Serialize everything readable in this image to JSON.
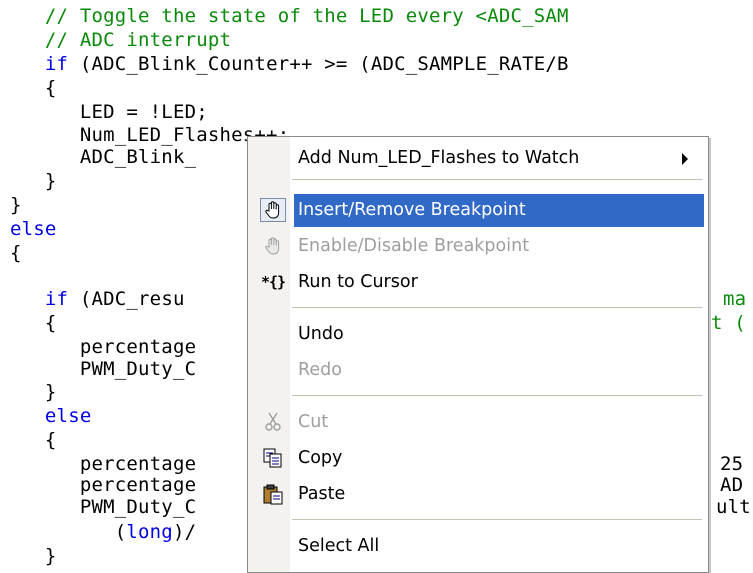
{
  "editor": {
    "lines": [
      {
        "text": "   // Toggle the state of the LED every <ADC_SAM",
        "kind": "comment"
      },
      {
        "text": "   // ADC interrupt",
        "kind": "comment"
      },
      {
        "text": "   if (ADC_Blink_Counter++ >= (ADC_SAMPLE_RATE/B",
        "kind": "if"
      },
      {
        "text": "   {",
        "kind": "normal"
      },
      {
        "text": "      LED = !LED;",
        "kind": "normal"
      },
      {
        "text": "      Num_LED_Flashes++;",
        "kind": "normal"
      },
      {
        "text": "      ADC_Blink_",
        "kind": "normal"
      },
      {
        "text": "   }",
        "kind": "normal"
      },
      {
        "text": "}",
        "kind": "normal"
      },
      {
        "text": "else",
        "kind": "keyword"
      },
      {
        "text": "{",
        "kind": "normal"
      },
      {
        "text": "",
        "kind": "normal"
      },
      {
        "text": "   if (ADC_resu",
        "kind": "if"
      },
      {
        "text": "   {",
        "kind": "normal"
      },
      {
        "text": "      percentage",
        "kind": "normal"
      },
      {
        "text": "      PWM_Duty_C",
        "kind": "normal"
      },
      {
        "text": "   }",
        "kind": "normal"
      },
      {
        "text": "   else",
        "kind": "keyword"
      },
      {
        "text": "   {",
        "kind": "normal"
      },
      {
        "text": "      percentage",
        "kind": "normal"
      },
      {
        "text": "      percentage",
        "kind": "normal"
      },
      {
        "text": "      PWM_Duty_C",
        "kind": "normal"
      },
      {
        "text": "         (long)/",
        "kind": "long"
      },
      {
        "text": "   }",
        "kind": "normal"
      }
    ],
    "right_fragments": [
      "ma",
      "t (",
      "25",
      "AD",
      "ult"
    ]
  },
  "context_menu": {
    "items": [
      {
        "label": "Add Num_LED_Flashes to Watch",
        "icon": "",
        "has_submenu": true
      },
      {
        "label": "Insert/Remove Breakpoint",
        "icon": "hand-breakpoint-icon",
        "highlighted": true
      },
      {
        "label": "Enable/Disable Breakpoint",
        "icon": "hand-breakpoint-disabled-icon",
        "disabled": true
      },
      {
        "label": "Run to Cursor",
        "icon": "run-to-cursor-icon",
        "icon_glyph": "*{}"
      },
      {
        "label": "Undo",
        "icon": ""
      },
      {
        "label": "Redo",
        "icon": "",
        "disabled": true
      },
      {
        "label": "Cut",
        "icon": "scissors-icon",
        "disabled": true
      },
      {
        "label": "Copy",
        "icon": "copy-icon"
      },
      {
        "label": "Paste",
        "icon": "paste-icon"
      },
      {
        "label": "Select All",
        "icon": ""
      }
    ]
  },
  "colors": {
    "comment": "#0a8a0a",
    "keyword": "#0000e6",
    "highlight": "#3169c6",
    "disabled_text": "#9e9e9e"
  }
}
